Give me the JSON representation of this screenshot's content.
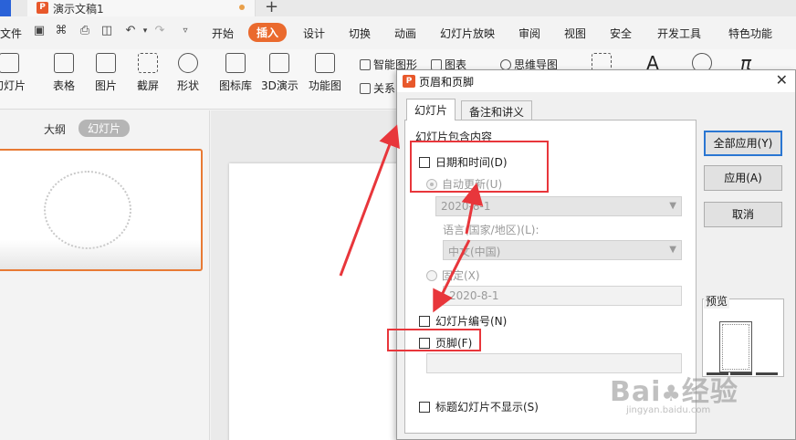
{
  "titlebar": {
    "doc_title": "演示文稿1",
    "new_tab": "+"
  },
  "menubar": {
    "file": "文件",
    "items": [
      "开始",
      "插入",
      "设计",
      "切换",
      "动画",
      "幻灯片放映",
      "审阅",
      "视图",
      "安全",
      "开发工具",
      "特色功能"
    ],
    "active": "插入"
  },
  "ribbon": {
    "new_slide": "幻灯片",
    "table": "表格",
    "picture": "图片",
    "screenshot": "截屏",
    "shape": "形状",
    "icon_library": "图标库",
    "demo_3d": "3D演示",
    "function_chart": "功能图",
    "smart_art": "智能图形",
    "chart": "图表",
    "mindmap": "思维导图",
    "relation": "关系"
  },
  "left_panel": {
    "outline_tab": "大纲",
    "slides_tab": "幻灯片"
  },
  "dialog": {
    "title": "页眉和页脚",
    "close": "✕",
    "tabs": [
      "幻灯片",
      "备注和讲义"
    ],
    "group_label": "幻灯片包含内容",
    "date_time": "日期和时间(D)",
    "auto_update": "自动更新(U)",
    "auto_date_value": "2020-8-1",
    "language_label": "语言(国家/地区)(L):",
    "language_value": "中文(中国)",
    "fixed": "固定(X)",
    "fixed_value": "2020-8-1",
    "slide_number": "幻灯片编号(N)",
    "footer": "页脚(F)",
    "footer_value": "",
    "hide_on_title": "标题幻灯片不显示(S)",
    "btn_apply_all": "全部应用(Y)",
    "btn_apply": "应用(A)",
    "btn_cancel": "取消",
    "preview_label": "预览"
  },
  "watermark": {
    "url": "jingyan.baidu.com"
  },
  "colors": {
    "accent": "#ea6a2e",
    "annotation": "#e8363b",
    "focus": "#2a76d2"
  }
}
